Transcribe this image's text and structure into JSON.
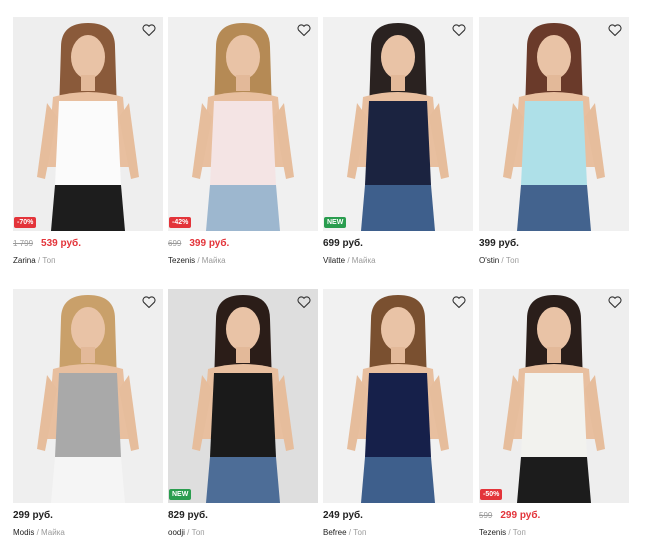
{
  "products": [
    {
      "brand": "Zarina",
      "sep": " / ",
      "category": "Топ",
      "old_price": "1 799",
      "price": "539 руб.",
      "badge": "-70%",
      "badge_type": "sale",
      "top_color": "#fbfbfb",
      "bottom_color": "#1d1d1d",
      "hair_color": "#8a5a3a",
      "bg_color": "#eeeeee"
    },
    {
      "brand": "Tezenis",
      "sep": " / ",
      "category": "Майка",
      "old_price": "699",
      "price": "399 руб.",
      "badge": "-42%",
      "badge_type": "sale",
      "top_color": "#f4e4e4",
      "bottom_color": "#9db7cf",
      "hair_color": "#b58a55",
      "bg_color": "#f0f0f0"
    },
    {
      "brand": "Vilatte",
      "sep": " / ",
      "category": "Майка",
      "old_price": "",
      "price": "699 руб.",
      "badge": "NEW",
      "badge_type": "new",
      "top_color": "#1b2340",
      "bottom_color": "#3e5f8c",
      "hair_color": "#2a2220",
      "bg_color": "#f1f1f1"
    },
    {
      "brand": "O'stin",
      "sep": " / ",
      "category": "Топ",
      "old_price": "",
      "price": "399 руб.",
      "badge": "",
      "badge_type": "",
      "top_color": "#aee0e8",
      "bottom_color": "#43638e",
      "hair_color": "#6a3a2a",
      "bg_color": "#f0f0f0"
    },
    {
      "brand": "Modis",
      "sep": " / ",
      "category": "Майка",
      "old_price": "",
      "price": "299 руб.",
      "badge": "",
      "badge_type": "",
      "top_color": "#a9a9a9",
      "bottom_color": "#f5f5f5",
      "hair_color": "#c9a06a",
      "bg_color": "#efefef"
    },
    {
      "brand": "oodji",
      "sep": " / ",
      "category": "Топ",
      "old_price": "",
      "price": "829 руб.",
      "badge": "NEW",
      "badge_type": "new",
      "top_color": "#1a1a1a",
      "bottom_color": "#4d6d97",
      "hair_color": "#2b1d18",
      "bg_color": "#dedede"
    },
    {
      "brand": "Befree",
      "sep": " / ",
      "category": "Топ",
      "old_price": "",
      "price": "249 руб.",
      "badge": "",
      "badge_type": "",
      "top_color": "#16204a",
      "bottom_color": "#3e5f8c",
      "hair_color": "#7a5030",
      "bg_color": "#f1f1f1"
    },
    {
      "brand": "Tezenis",
      "sep": " / ",
      "category": "Топ",
      "old_price": "599",
      "price": "299 руб.",
      "badge": "-50%",
      "badge_type": "sale",
      "top_color": "#f2f2ee",
      "bottom_color": "#1c1c1c",
      "hair_color": "#2a1e1a",
      "bg_color": "#eeeeee"
    }
  ],
  "favorite_icon": "heart-outline-icon",
  "colors": {
    "sale": "#e3343a",
    "new": "#2a9d4f",
    "muted": "#9a9a9a"
  }
}
